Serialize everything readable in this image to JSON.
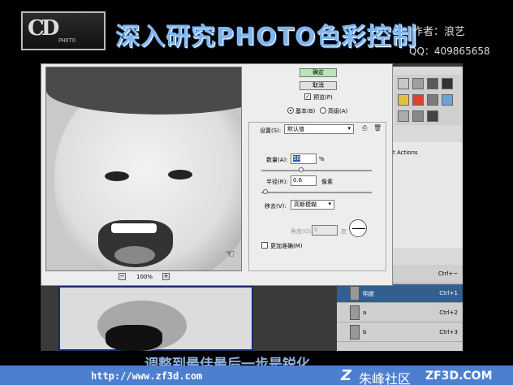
{
  "banner": {
    "logo_sub": "PHOTO",
    "title": "深入研究PHOTO色彩控制",
    "author": "作者：浪艺",
    "qq": "QQ：409865658"
  },
  "dialog": {
    "ok_label": "确定",
    "cancel_label": "取消",
    "preview_label": "预览(P)",
    "preview_checked": true,
    "mode_basic": "基本(B)",
    "mode_advanced": "高级(A)",
    "mode_selected": "basic",
    "settings_label": "设置(S):",
    "settings_value": "默认值",
    "amount_label": "数量(A):",
    "amount_value": "50",
    "amount_unit": "%",
    "radius_label": "半径(R):",
    "radius_value": "0.6",
    "radius_unit": "像素",
    "remove_label": "移去(V):",
    "remove_value": "高斯模糊",
    "angle_label": "角度(G):",
    "angle_value": "0",
    "angle_unit": "度",
    "more_accurate_label": "更加准确(M)",
    "zoom": "100%",
    "zoom_minus": "−",
    "zoom_plus": "+"
  },
  "actions_panel": {
    "label": "t Actions"
  },
  "layers": [
    {
      "name": "",
      "shortcut": "Ctrl+~"
    },
    {
      "name": "明度",
      "shortcut": "Ctrl+1",
      "active": true
    },
    {
      "name": "a",
      "shortcut": "Ctrl+2"
    },
    {
      "name": "b",
      "shortcut": "Ctrl+3"
    }
  ],
  "subtitle": "调整到最佳最后一步是锐化",
  "footer": {
    "url": "http://www.zf3d.com",
    "brand_mark": "Z",
    "brand": "朱峰社区",
    "domain": "ZF3D.COM"
  },
  "colors": {
    "accent": "#4d7fd0",
    "title": "#7fb6ef",
    "layer_active": "#335f8f",
    "ok_button": "#b7e5b7"
  }
}
